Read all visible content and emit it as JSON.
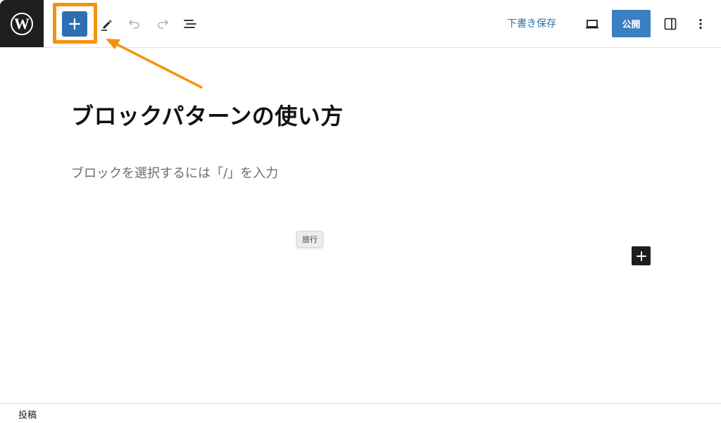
{
  "toolbar": {
    "logo_icon": "wordpress-logo",
    "inserter_icon": "plus-icon",
    "tools_icon": "pencil-icon",
    "undo_icon": "undo-icon",
    "redo_icon": "redo-icon",
    "list_view_icon": "list-view-icon",
    "save_draft_label": "下書き保存",
    "preview_icon": "laptop-icon",
    "publish_label": "公開",
    "settings_icon": "sidebar-icon",
    "options_icon": "more-vertical-icon"
  },
  "editor": {
    "post_title": "ブロックパターンの使い方",
    "paragraph_placeholder": "ブロックを選択するには「/」を入力",
    "tooltip": "旅行",
    "add_block_icon": "plus-icon"
  },
  "annotation": {
    "arrow_color": "#f2930f",
    "highlight_color": "#f2930f"
  },
  "footer": {
    "breadcrumb": "投稿"
  },
  "colors": {
    "accent": "#2271b1",
    "publish_bg": "#3a7fc0",
    "inserter_bg": "#2d6fb0",
    "dark": "#1e1e1e"
  }
}
